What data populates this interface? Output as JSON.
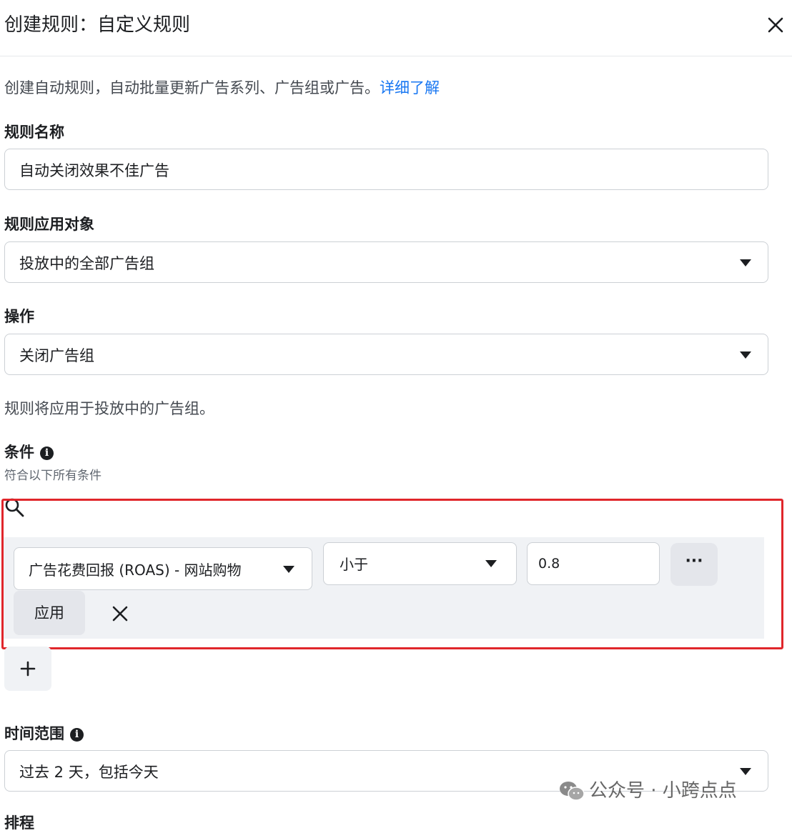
{
  "dialog": {
    "title": "创建规则：自定义规则"
  },
  "intro": {
    "text": "创建自动规则，自动批量更新广告系列、广告组或广告。",
    "link": "详细了解"
  },
  "rule_name": {
    "label": "规则名称",
    "value": "自动关闭效果不佳广告"
  },
  "apply_to": {
    "label": "规则应用对象",
    "value": "投放中的全部广告组"
  },
  "action": {
    "label": "操作",
    "value": "关闭广告组"
  },
  "applies_note": "规则将应用于投放中的广告组。",
  "conditions": {
    "label": "条件",
    "sublabel": "符合以下所有条件",
    "metric": "广告花费回报 (ROAS) - 网站购物",
    "operator": "小于",
    "value": "0.8",
    "more": "···",
    "apply": "应用"
  },
  "time_range": {
    "label": "时间范围",
    "value": "过去 2 天，包括今天"
  },
  "next_label": "排程",
  "watermark": "公众号 · 小跨点点",
  "colors": {
    "highlight": "#e0262b",
    "link": "#1877f2"
  },
  "icons": [
    "close-icon",
    "caret-down-icon",
    "info-icon",
    "search-icon",
    "remove-icon",
    "plus-icon",
    "wechat-icon"
  ]
}
